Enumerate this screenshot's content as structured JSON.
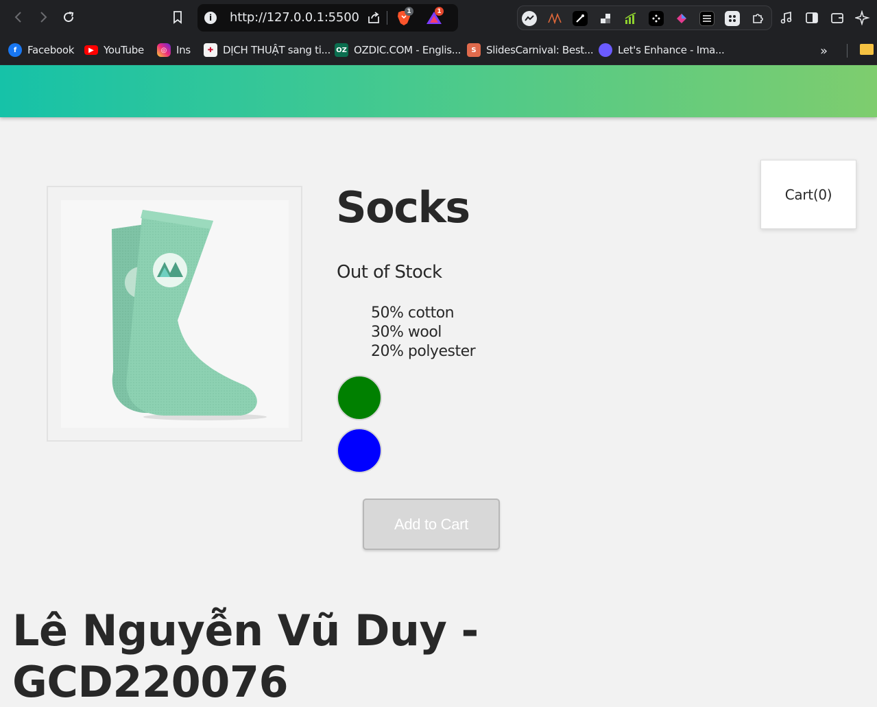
{
  "browser": {
    "url": "http://127.0.0.1:5500",
    "brave_badge": "1",
    "rewards_badge": "1",
    "bookmarks": [
      {
        "label": "Facebook",
        "icon": "facebook-icon",
        "color": "#1877f2"
      },
      {
        "label": "YouTube",
        "icon": "youtube-icon",
        "color": "#ff0000"
      },
      {
        "label": "Ins",
        "icon": "instagram-icon",
        "color": "#d6249f"
      },
      {
        "label": "DỊCH THUẬT sang ti...",
        "icon": "cambridge-icon",
        "color": "#c8102e"
      },
      {
        "label": "OZDIC.COM - Englis...",
        "icon": "ozdic-icon",
        "color": "#0b6e4f"
      },
      {
        "label": "SlidesCarnival: Best...",
        "icon": "slidescarnival-icon",
        "color": "#e06a4c"
      },
      {
        "label": "Let's Enhance - Ima...",
        "icon": "letsenhance-icon",
        "color": "#6b5bff"
      }
    ]
  },
  "page": {
    "header_gradient": [
      "#16c2a8",
      "#7ecd6e"
    ],
    "product": {
      "title": "Socks",
      "stock_status": "Out of Stock",
      "details": [
        "50% cotton",
        "30% wool",
        "20% polyester"
      ],
      "variants": [
        {
          "color": "#008000",
          "name": "green"
        },
        {
          "color": "#0000ff",
          "name": "blue"
        }
      ],
      "add_to_cart_label": "Add to Cart",
      "sock_color": "#8dd1b2"
    },
    "cart_label": "Cart(0)",
    "footer_line1": "Lê Nguyễn Vũ Duy -",
    "footer_line2": "GCD220076"
  }
}
